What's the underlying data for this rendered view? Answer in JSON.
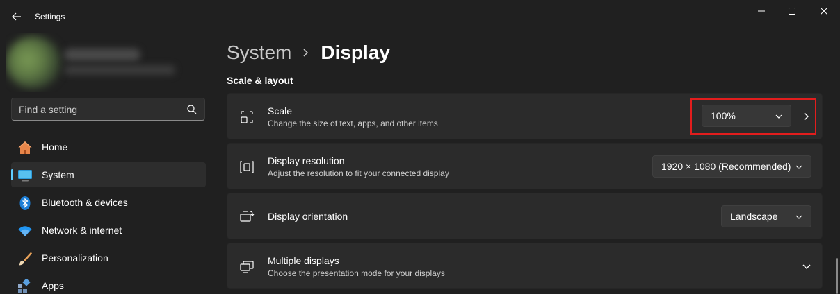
{
  "window": {
    "title": "Settings"
  },
  "search": {
    "placeholder": "Find a setting"
  },
  "sidebar": {
    "items": [
      {
        "label": "Home",
        "icon": "home-icon",
        "active": false
      },
      {
        "label": "System",
        "icon": "system-monitor-icon",
        "active": true
      },
      {
        "label": "Bluetooth & devices",
        "icon": "bluetooth-icon",
        "active": false
      },
      {
        "label": "Network & internet",
        "icon": "wifi-icon",
        "active": false
      },
      {
        "label": "Personalization",
        "icon": "paintbrush-icon",
        "active": false
      },
      {
        "label": "Apps",
        "icon": "apps-icon",
        "active": false
      }
    ]
  },
  "breadcrumb": {
    "parent": "System",
    "current": "Display"
  },
  "section": {
    "title": "Scale & layout"
  },
  "settings": {
    "scale": {
      "title": "Scale",
      "description": "Change the size of text, apps, and other items",
      "value": "100%"
    },
    "resolution": {
      "title": "Display resolution",
      "description": "Adjust the resolution to fit your connected display",
      "value": "1920 × 1080 (Recommended)"
    },
    "orientation": {
      "title": "Display orientation",
      "value": "Landscape"
    },
    "multiple_displays": {
      "title": "Multiple displays",
      "description": "Choose the presentation mode for your displays"
    }
  },
  "colors": {
    "background": "#202020",
    "card": "#2b2b2b",
    "accent": "#60cdff",
    "highlight": "#e21d1d"
  }
}
